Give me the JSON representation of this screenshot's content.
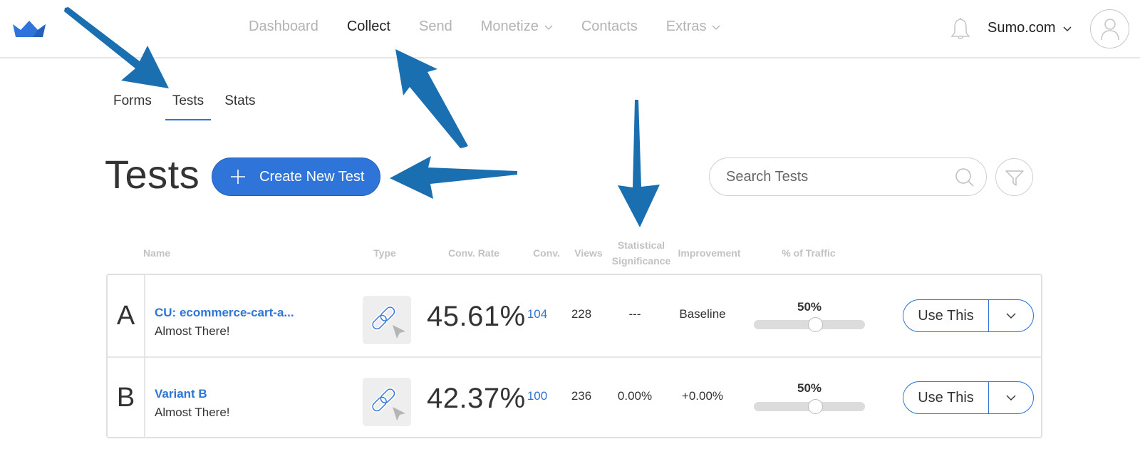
{
  "brand": {
    "logo_icon": "crown-icon",
    "accent_color": "#2f74d8"
  },
  "topnav": {
    "items": [
      {
        "label": "Dashboard",
        "active": false,
        "has_dropdown": false
      },
      {
        "label": "Collect",
        "active": true,
        "has_dropdown": false
      },
      {
        "label": "Send",
        "active": false,
        "has_dropdown": false
      },
      {
        "label": "Monetize",
        "active": false,
        "has_dropdown": true
      },
      {
        "label": "Contacts",
        "active": false,
        "has_dropdown": false
      },
      {
        "label": "Extras",
        "active": false,
        "has_dropdown": true
      }
    ],
    "notifications_icon": "bell-icon",
    "account_label": "Sumo.com",
    "avatar_icon": "user-icon"
  },
  "subnav": {
    "items": [
      {
        "label": "Forms",
        "active": false
      },
      {
        "label": "Tests",
        "active": true
      },
      {
        "label": "Stats",
        "active": false
      }
    ]
  },
  "page": {
    "title": "Tests",
    "create_button_label": "Create New Test",
    "search_placeholder": "Search Tests",
    "filter_icon": "funnel-icon"
  },
  "table": {
    "columns": {
      "name": "Name",
      "type": "Type",
      "conv_rate": "Conv. Rate",
      "conv": "Conv.",
      "views": "Views",
      "stat_sig_line1": "Statistical",
      "stat_sig_line2": "Significance",
      "improvement": "Improvement",
      "traffic": "% of Traffic"
    },
    "rows": [
      {
        "letter": "A",
        "name": "CU: ecommerce-cart-a...",
        "subtitle": "Almost There!",
        "type_icon": "link-click-icon",
        "conv_rate": "45.61%",
        "conv": "104",
        "views": "228",
        "significance": "---",
        "improvement": "Baseline",
        "traffic_label": "50%",
        "traffic_fraction": 0.5,
        "use_label": "Use This"
      },
      {
        "letter": "B",
        "name": "Variant B",
        "subtitle": "Almost There!",
        "type_icon": "link-click-icon",
        "conv_rate": "42.37%",
        "conv": "100",
        "views": "236",
        "significance": "0.00%",
        "improvement": "+0.00%",
        "traffic_label": "50%",
        "traffic_fraction": 0.5,
        "use_label": "Use This"
      }
    ]
  },
  "annotations": {
    "arrow_color": "#1a6fb0",
    "arrows": [
      "points-to-tests-tab",
      "points-to-collect-nav",
      "points-to-create-button",
      "points-to-significance-column"
    ]
  }
}
